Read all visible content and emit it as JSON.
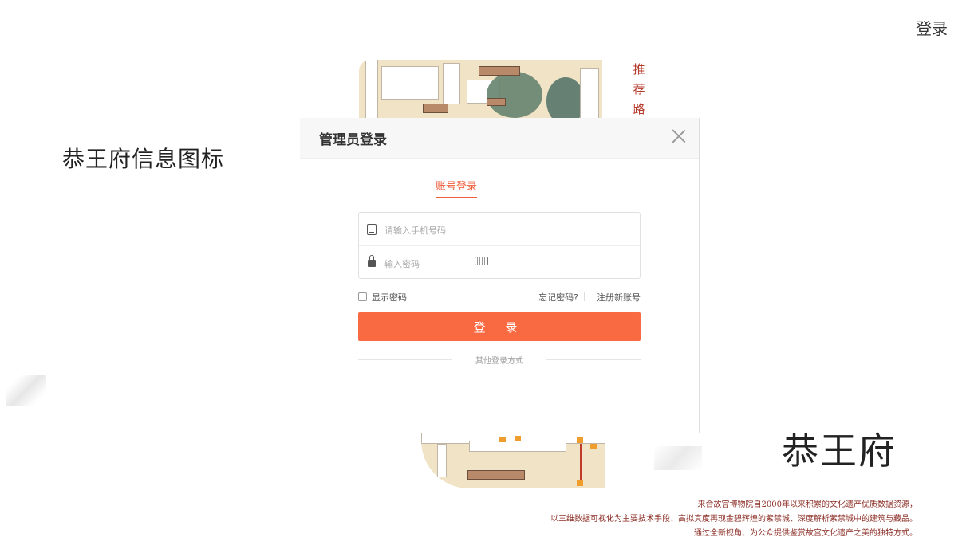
{
  "header": {
    "login_link": "登录"
  },
  "left_title": "恭王府信息图标",
  "map": {
    "recommend_chars": [
      "推",
      "荐",
      "路"
    ]
  },
  "brand": {
    "title": "恭王府"
  },
  "description": [
    "来合故宫博物院自2000年以来积累的文化遗产优质数据资源，",
    "以三维数据可视化为主要技术手段、高拟真度再现金碧辉煌的紫禁城、深度解析紫禁城中的建筑与藏品。",
    "通过全新视角、为公众提供鉴赏故宫文化遗产之美的独特方式。"
  ],
  "modal": {
    "title": "管理员登录",
    "tab": "账号登录",
    "phone_placeholder": "请输入手机号码",
    "password_placeholder": "输入密码",
    "show_password": "显示密码",
    "forgot_password": "忘记密码?",
    "register": "注册新账号",
    "submit": "登 录",
    "other_login": "其他登录方式"
  },
  "colors": {
    "accent": "#f96a43",
    "title_red": "#b53a2b"
  }
}
